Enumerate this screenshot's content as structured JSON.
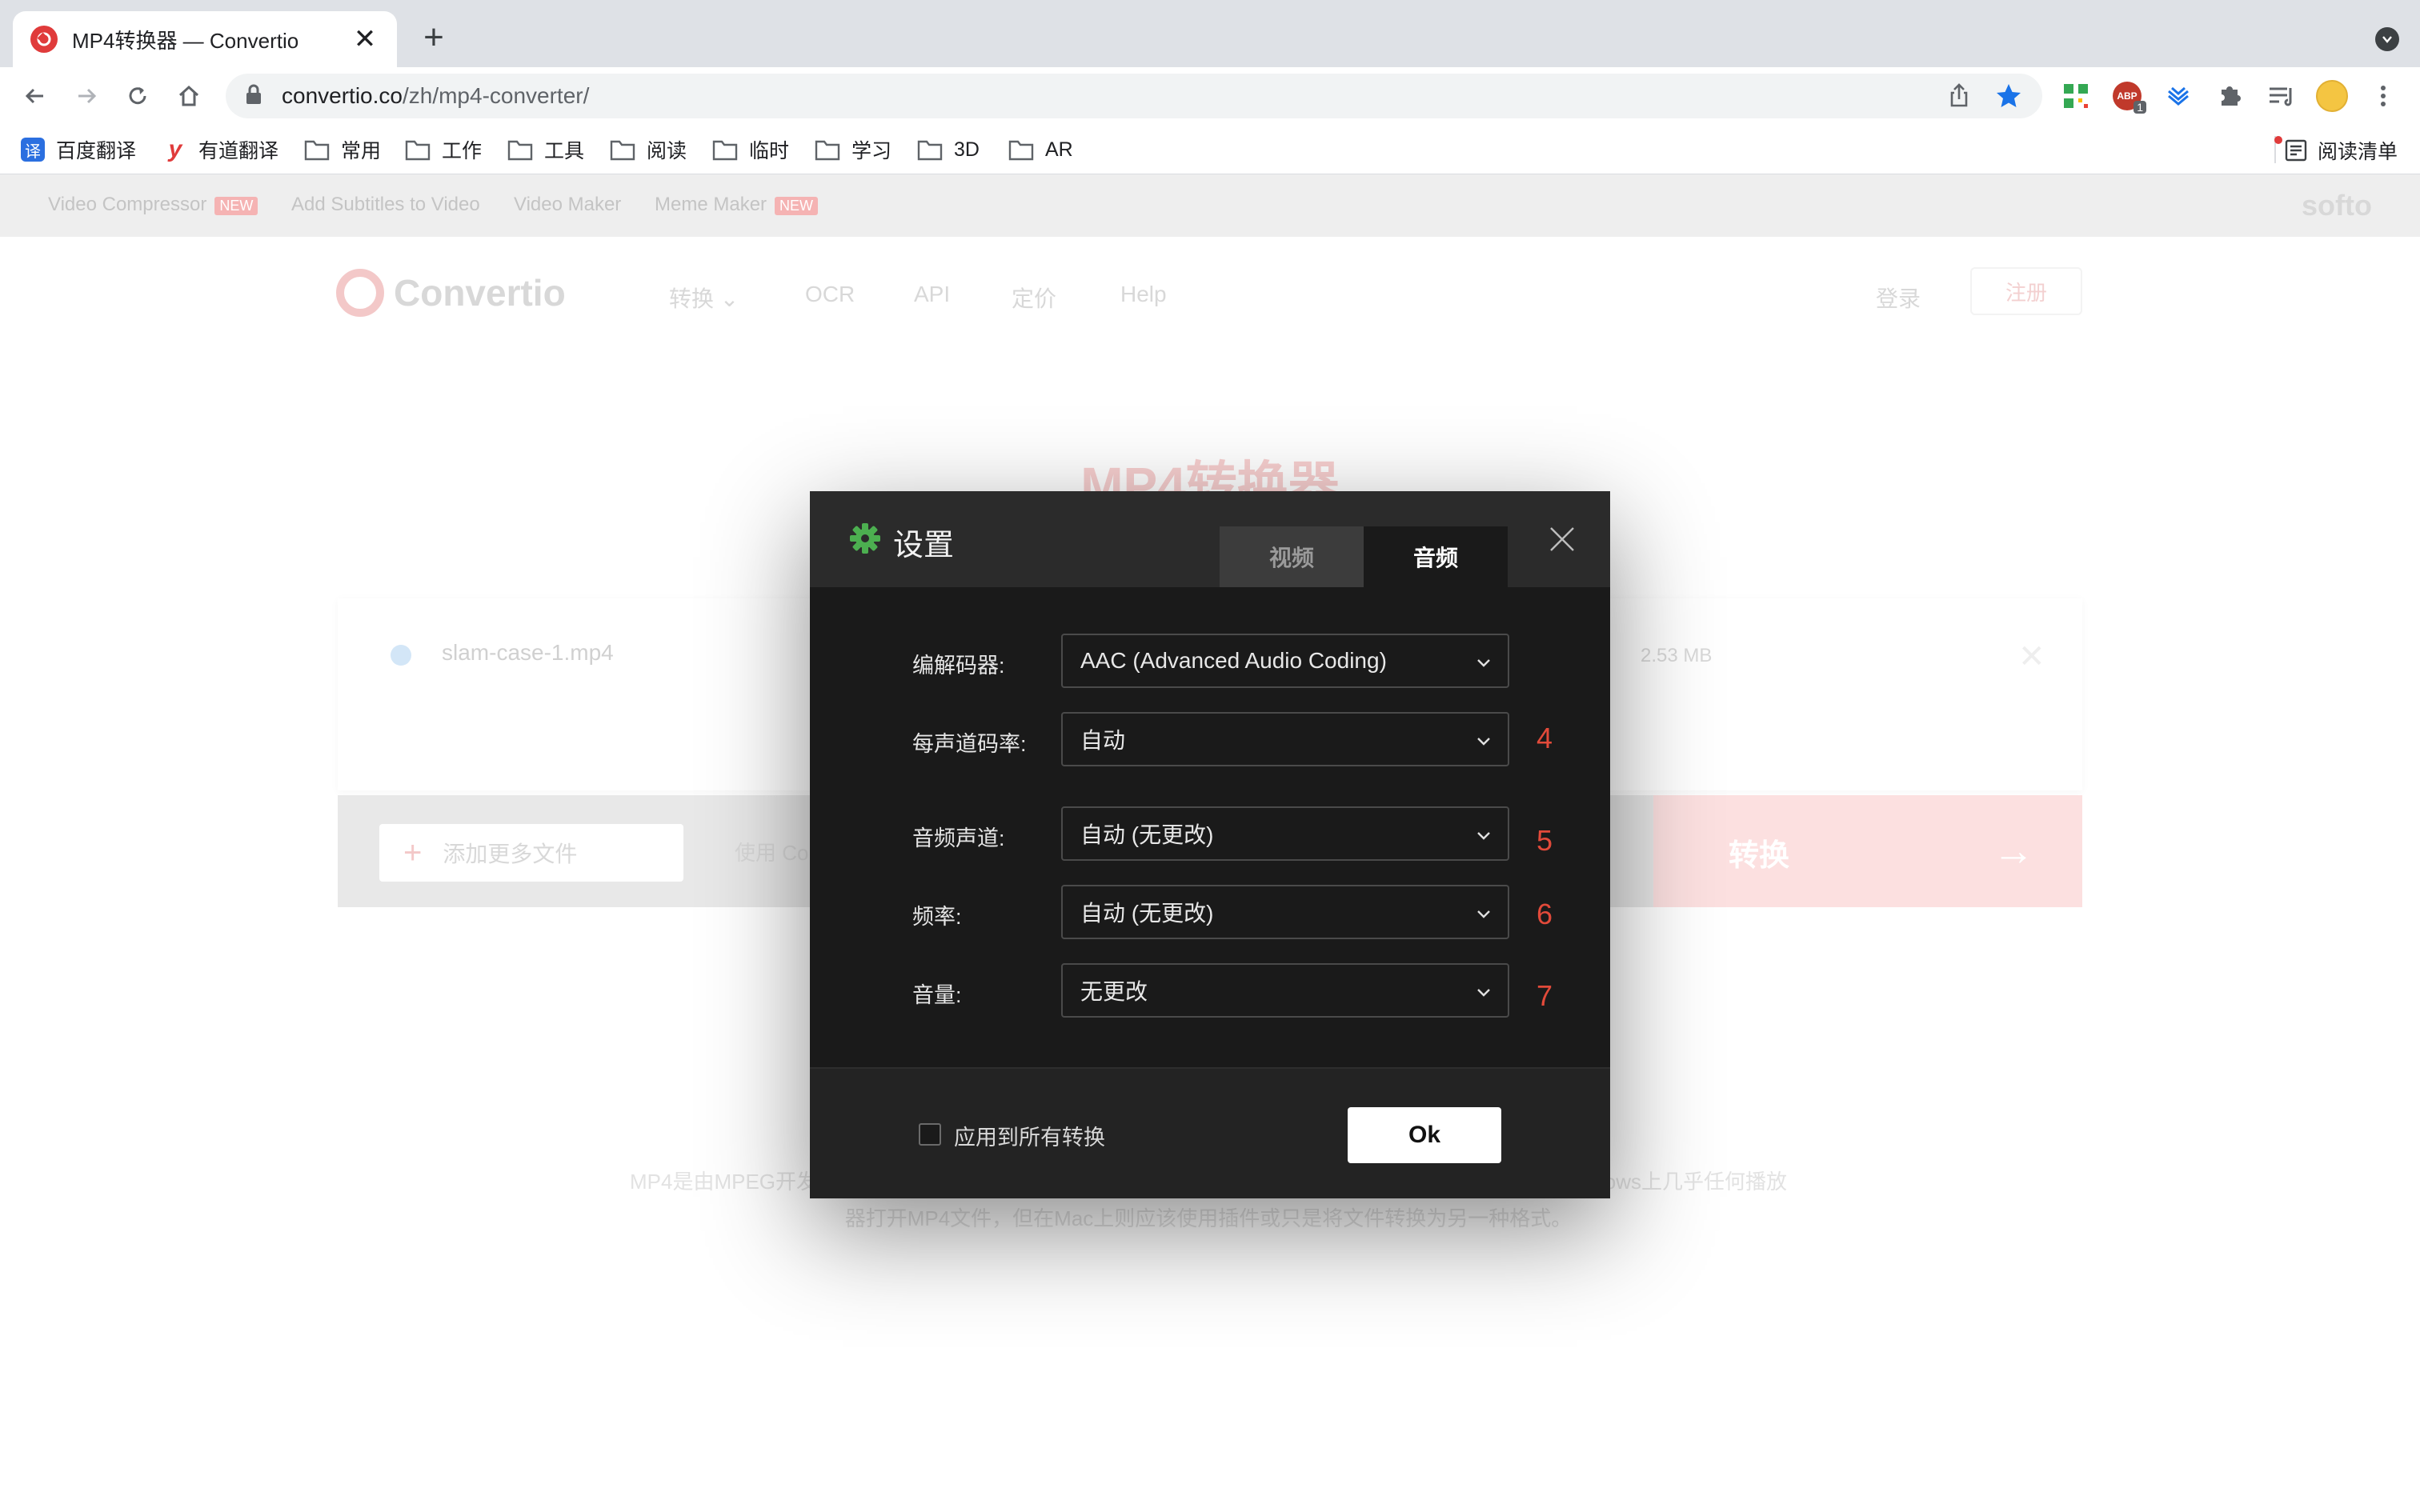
{
  "browser": {
    "tab": {
      "title": "MP4转换器 — Convertio",
      "close": "✕"
    },
    "new_tab": "+",
    "url": {
      "host": "convertio.co",
      "path": "/zh/mp4-converter/"
    },
    "bookmarks": [
      {
        "label": "百度翻译",
        "icon": "baidu-fanyi-icon",
        "glyph": "译"
      },
      {
        "label": "有道翻译",
        "icon": "youdao-icon",
        "glyph": "y"
      },
      {
        "label": "常用",
        "icon": "folder-icon"
      },
      {
        "label": "工作",
        "icon": "folder-icon"
      },
      {
        "label": "工具",
        "icon": "folder-icon"
      },
      {
        "label": "阅读",
        "icon": "folder-icon"
      },
      {
        "label": "临时",
        "icon": "folder-icon"
      },
      {
        "label": "学习",
        "icon": "folder-icon"
      },
      {
        "label": "3D",
        "icon": "folder-icon"
      },
      {
        "label": "AR",
        "icon": "folder-icon"
      }
    ],
    "reading_list": "阅读清单",
    "extension_badge": "1"
  },
  "site": {
    "topstrip": {
      "items": [
        "Video Compressor",
        "Add Subtitles to Video",
        "Video Maker",
        "Meme Maker"
      ],
      "new_badge": "NEW",
      "brand": "softo"
    },
    "logo_text": "Convertio",
    "nav": [
      "转换",
      "OCR",
      "API",
      "定价",
      "Help"
    ],
    "login": "登录",
    "signup": "注册",
    "page_title": "MP4转换器",
    "file": {
      "name": "slam-case-1.mp4",
      "size": "2.53 MB"
    },
    "add_more": "添加更多文件",
    "use_cloud": "使用 Co",
    "convert": "转换",
    "description": "MP4是由MPEG开发的一种多媒体容器格式，可以用于存储视频、音频、字幕、2D和3D图形。可以在Windows上几乎任何播放器打开MP4文件，但在Mac上则应该使用插件或只是将文件转换为另一种格式。"
  },
  "modal": {
    "title": "设置",
    "tabs": [
      {
        "label": "视频",
        "active": false
      },
      {
        "label": "音频",
        "active": true
      }
    ],
    "rows": [
      {
        "label": "编解码器:",
        "value": "AAC (Advanced Audio Coding)",
        "annotation": ""
      },
      {
        "label": "每声道码率:",
        "value": "自动",
        "annotation": "4"
      },
      {
        "label": "音频声道:",
        "value": "自动 (无更改)",
        "annotation": "5"
      },
      {
        "label": "频率:",
        "value": "自动 (无更改)",
        "annotation": "6"
      },
      {
        "label": "音量:",
        "value": "无更改",
        "annotation": "7"
      }
    ],
    "apply_all": "应用到所有转换",
    "ok": "Ok"
  },
  "colors": {
    "accent_green": "#4caf50",
    "annotation_red": "#e24a3a",
    "brand_red": "#e03b3b"
  }
}
